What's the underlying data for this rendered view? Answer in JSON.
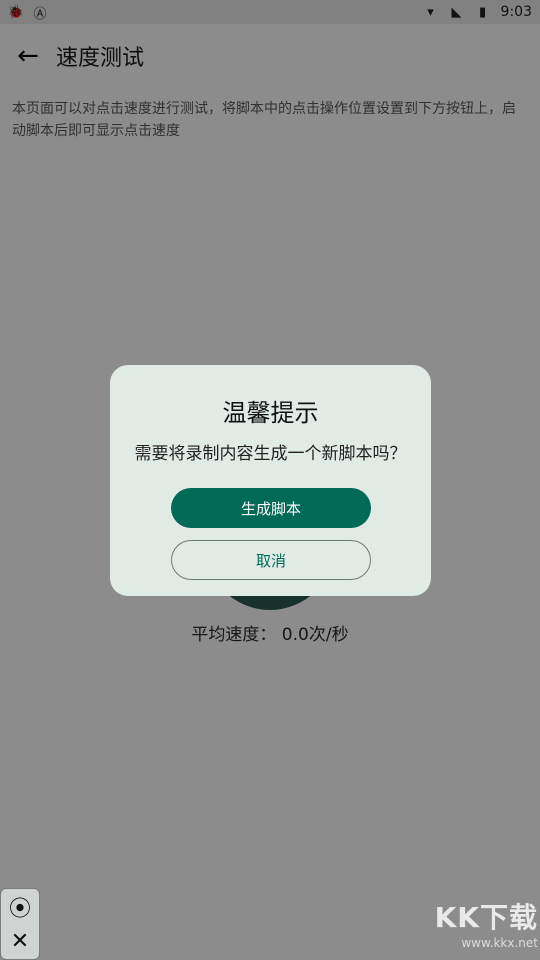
{
  "status_bar": {
    "left_icons": [
      "bug-icon",
      "a-notification-icon"
    ],
    "right_icons": [
      "wifi-icon",
      "signal-icon",
      "battery-icon"
    ],
    "time": "9:03"
  },
  "toolbar": {
    "back_icon": "arrow-left-icon",
    "title": "速度测试"
  },
  "description": "本页面可以对点击速度进行测试，将脚本中的点击操作位置设置到下方按钮上，启动脚本后即可显示点击速度",
  "speed_label": "平均速度： 0.0次/秒",
  "dialog": {
    "title": "温馨提示",
    "message": "需要将录制内容生成一个新脚本吗？",
    "primary_button": "生成脚本",
    "secondary_button": "取消"
  },
  "float_panel": {
    "icons": [
      "record-target-icon",
      "close-icon"
    ]
  },
  "watermark": {
    "brand": "KK下载",
    "url": "www.kkx.net"
  },
  "colors": {
    "accent": "#006a57",
    "dialog_bg": "#e0ebe6",
    "overlay": "rgba(0,0,0,0.45)"
  }
}
